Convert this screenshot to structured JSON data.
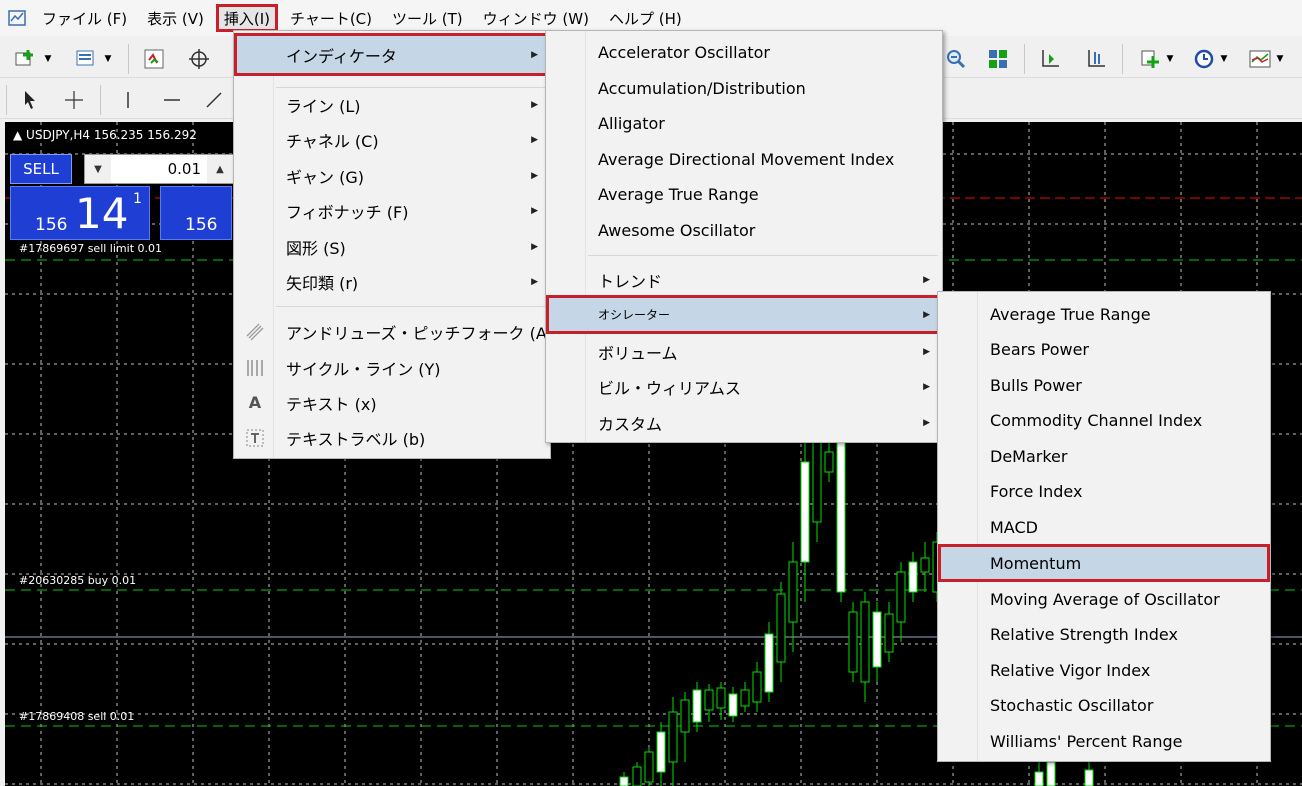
{
  "menubar": {
    "items": [
      {
        "label": "ファイル (F)"
      },
      {
        "label": "表示 (V)"
      },
      {
        "label": "挿入(I)"
      },
      {
        "label": "チャート(C)"
      },
      {
        "label": "ツール (T)"
      },
      {
        "label": "ウィンドウ (W)"
      },
      {
        "label": "ヘルプ (H)"
      }
    ]
  },
  "chart": {
    "symbol_info": "USDJPY,H4  156.235 156.292",
    "orders": {
      "sell_limit": "#17869697 sell limit 0.01",
      "buy": "#20630285 buy 0.01",
      "sell": "#17869408 sell 0.01"
    }
  },
  "trade_panel": {
    "sell_label": "SELL",
    "lot": "0.01",
    "sell_price_small": "156",
    "sell_price_big": "14",
    "sell_price_sup": "1",
    "buy_price_small": "156"
  },
  "insert_menu": {
    "items": [
      {
        "label": "インディケータ",
        "has_submenu": true
      },
      {
        "label": "ライン (L)",
        "has_submenu": true
      },
      {
        "label": "チャネル (C)",
        "has_submenu": true
      },
      {
        "label": "ギャン (G)",
        "has_submenu": true
      },
      {
        "label": "フィボナッチ (F)",
        "has_submenu": true
      },
      {
        "label": "図形 (S)",
        "has_submenu": true
      },
      {
        "label": "矢印類 (r)",
        "has_submenu": true
      },
      {
        "label": "アンドリューズ・ピッチフォーク (A)",
        "icon": "pitchfork-icon"
      },
      {
        "label": "サイクル・ライン (Y)",
        "icon": "cycle-lines-icon"
      },
      {
        "label": "テキスト (x)",
        "icon": "text-icon"
      },
      {
        "label": "テキストラベル (b)",
        "icon": "text-label-icon"
      }
    ]
  },
  "indicator_menu": {
    "items": [
      {
        "label": "Accelerator Oscillator"
      },
      {
        "label": "Accumulation/Distribution"
      },
      {
        "label": "Alligator"
      },
      {
        "label": "Average Directional Movement Index"
      },
      {
        "label": "Average True Range"
      },
      {
        "label": "Awesome Oscillator"
      },
      {
        "label": "トレンド",
        "has_submenu": true
      },
      {
        "label": "オシレーター",
        "has_submenu": true
      },
      {
        "label": "ボリューム",
        "has_submenu": true
      },
      {
        "label": "ビル・ウィリアムス",
        "has_submenu": true
      },
      {
        "label": "カスタム",
        "has_submenu": true
      }
    ]
  },
  "oscillator_menu": {
    "items": [
      {
        "label": "Average True Range"
      },
      {
        "label": "Bears Power"
      },
      {
        "label": "Bulls Power"
      },
      {
        "label": "Commodity Channel Index"
      },
      {
        "label": "DeMarker"
      },
      {
        "label": "Force Index"
      },
      {
        "label": "MACD"
      },
      {
        "label": "Momentum"
      },
      {
        "label": "Moving Average of Oscillator"
      },
      {
        "label": "Relative Strength Index"
      },
      {
        "label": "Relative Vigor Index"
      },
      {
        "label": "Stochastic Oscillator"
      },
      {
        "label": "Williams' Percent Range"
      }
    ]
  },
  "colors": {
    "highlight": "#c5d6e6",
    "annotation_red": "#c8202a",
    "candle_green": "#00e000",
    "grid": "#c0c0c0",
    "sell_blue": "#1f3fd4"
  }
}
